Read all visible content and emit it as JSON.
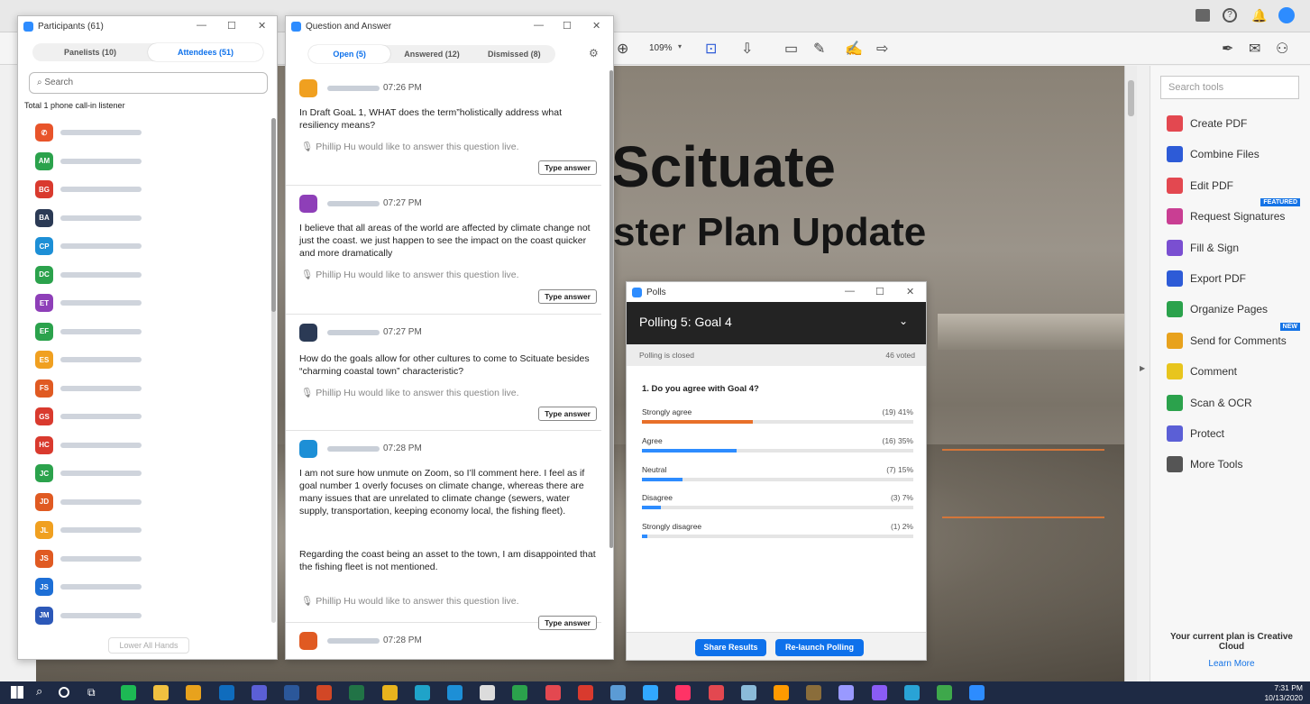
{
  "acrobat": {
    "zoom": "109%",
    "doc_title_1": "Scituate",
    "doc_title_2": "ster Plan Update",
    "tools_search_placeholder": "Search tools",
    "tools": [
      {
        "label": "Create PDF",
        "icon": "create-pdf-icon",
        "color": "#e34850"
      },
      {
        "label": "Combine Files",
        "icon": "combine-files-icon",
        "color": "#2d5bd7"
      },
      {
        "label": "Edit PDF",
        "icon": "edit-pdf-icon",
        "color": "#e34850"
      },
      {
        "label": "Request Signatures",
        "icon": "request-signatures-icon",
        "color": "#c93e93",
        "badge": "FEATURED"
      },
      {
        "label": "Fill & Sign",
        "icon": "fill-sign-icon",
        "color": "#7a4fd1"
      },
      {
        "label": "Export PDF",
        "icon": "export-pdf-icon",
        "color": "#2d5bd7"
      },
      {
        "label": "Organize Pages",
        "icon": "organize-pages-icon",
        "color": "#2ba24c"
      },
      {
        "label": "Send for Comments",
        "icon": "send-comments-icon",
        "color": "#e8a21d",
        "badge": "NEW"
      },
      {
        "label": "Comment",
        "icon": "comment-icon",
        "color": "#e8c51d"
      },
      {
        "label": "Scan & OCR",
        "icon": "scan-ocr-icon",
        "color": "#2ba24c"
      },
      {
        "label": "Protect",
        "icon": "protect-icon",
        "color": "#5b5fd6"
      },
      {
        "label": "More Tools",
        "icon": "more-tools-icon",
        "color": "#555555"
      }
    ],
    "plan_text": "Your current plan is Creative Cloud",
    "learn_more": "Learn More"
  },
  "participants": {
    "title": "Participants (61)",
    "tab_panelists": "Panelists (10)",
    "tab_attendees": "Attendees (51)",
    "search_placeholder": "Search",
    "total_text": "Total 1 phone call-in listener",
    "rows": [
      {
        "initials": "",
        "color": "#e8542a"
      },
      {
        "initials": "AM",
        "color": "#2ba24c"
      },
      {
        "initials": "BG",
        "color": "#d93a2e"
      },
      {
        "initials": "BA",
        "color": "#2b3a55"
      },
      {
        "initials": "CP",
        "color": "#1d8fd6"
      },
      {
        "initials": "DC",
        "color": "#2ba24c"
      },
      {
        "initials": "ET",
        "color": "#8e3fb8"
      },
      {
        "initials": "EF",
        "color": "#2ba24c"
      },
      {
        "initials": "ES",
        "color": "#f0a020"
      },
      {
        "initials": "FS",
        "color": "#e05a22"
      },
      {
        "initials": "GS",
        "color": "#d93a2e"
      },
      {
        "initials": "HC",
        "color": "#d93a2e"
      },
      {
        "initials": "JC",
        "color": "#2ba24c"
      },
      {
        "initials": "JD",
        "color": "#e05a22"
      },
      {
        "initials": "JL",
        "color": "#f0a020"
      },
      {
        "initials": "JS",
        "color": "#e05a22"
      },
      {
        "initials": "JS",
        "color": "#1d6fd6"
      },
      {
        "initials": "JM",
        "color": "#2c58b8"
      }
    ],
    "lower_all_hands": "Lower All Hands"
  },
  "qa": {
    "title": "Question and Answer",
    "tab_open": "Open (5)",
    "tab_answered": "Answered (12)",
    "tab_dismissed": "Dismissed (8)",
    "live_text": "Phillip Hu would like to answer this question live.",
    "type_answer": "Type answer",
    "questions": [
      {
        "time": "07:26 PM",
        "color": "#f0a020",
        "text": "In Draft GoaL 1, WHAT does the term”holistically address what resiliency means?"
      },
      {
        "time": "07:27 PM",
        "color": "#8e3fb8",
        "text": "I believe that all areas of the world are affected by climate change not just the coast. we just happen to see the impact on the coast quicker and more dramatically"
      },
      {
        "time": "07:27 PM",
        "color": "#2b3a55",
        "text": "How do the goals allow for other cultures to come to Scituate besides “charming coastal town” characteristic?"
      },
      {
        "time": "07:28 PM",
        "color": "#1d8fd6",
        "text": "I am not sure how unmute on Zoom, so I’ll comment here.  I feel as if goal number 1 overly focuses on climate change, whereas there are many issues that are unrelated to climate change (sewers, water supply, transportation, keeping economy local, the fishing fleet).",
        "text2": "Regarding the coast being an asset to the town, I am disappointed that the fishing fleet is not mentioned."
      },
      {
        "time": "07:28 PM",
        "color": "#e05a22",
        "text": ""
      }
    ]
  },
  "polls": {
    "title": "Polls",
    "poll_name": "Polling 5: Goal 4",
    "status": "Polling is closed",
    "voted": "46 voted",
    "question": "1. Do you agree with Goal 4?",
    "options": [
      {
        "label": "Strongly agree",
        "value": "(19) 41%",
        "fraction": 0.41,
        "color": "#e8702a"
      },
      {
        "label": "Agree",
        "value": "(16) 35%",
        "fraction": 0.35,
        "color": "#2d8cff"
      },
      {
        "label": "Neutral",
        "value": "(7) 15%",
        "fraction": 0.15,
        "color": "#2d8cff"
      },
      {
        "label": "Disagree",
        "value": "(3) 7%",
        "fraction": 0.07,
        "color": "#2d8cff"
      },
      {
        "label": "Strongly disagree",
        "value": "(1) 2%",
        "fraction": 0.02,
        "color": "#2d8cff"
      }
    ],
    "share_results": "Share Results",
    "relaunch": "Re-launch Polling"
  },
  "taskbar": {
    "time": "7:31 PM",
    "date": "10/13/2020"
  }
}
